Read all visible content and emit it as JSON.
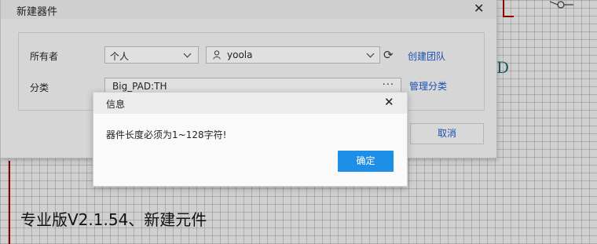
{
  "main_dialog": {
    "title": "新建器件",
    "owner_label": "所有者",
    "owner_type": "个人",
    "owner_user": "yoola",
    "create_team_link": "创建团队",
    "category_label": "分类",
    "category_value": "Big_PAD:TH",
    "category_more": "···",
    "manage_category_link": "管理分类",
    "cancel_button": "取消"
  },
  "info_dialog": {
    "title": "信息",
    "message": "器件长度必须为1~128字符!",
    "ok_button": "确定"
  },
  "canvas": {
    "text_fragment": "D"
  },
  "caption": "专业版V2.1.54、新建元件",
  "colors": {
    "ok_button_bg": "#1e8fe6",
    "link": "#1a4fb4",
    "schematic_border": "#8b0000"
  }
}
